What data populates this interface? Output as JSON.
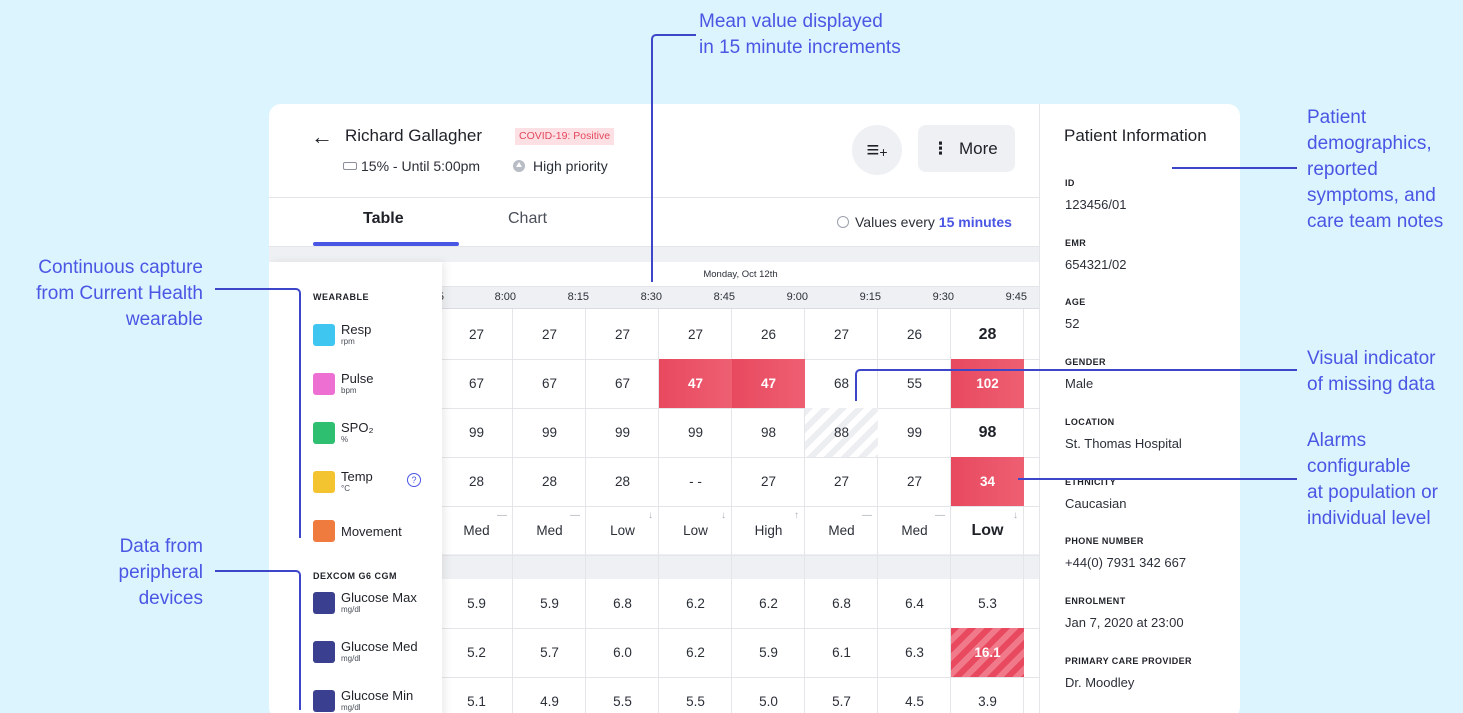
{
  "callouts": {
    "mean": [
      "Mean value displayed",
      "in 15 minute increments"
    ],
    "demographics": [
      "Patient",
      "demographics,",
      "reported",
      "symptoms, and",
      "care team notes"
    ],
    "continuous": [
      "Continuous capture",
      "from Current Health",
      "wearable"
    ],
    "missing": [
      "Visual indicator",
      "of missing data"
    ],
    "alarms": [
      "Alarms",
      "configurable",
      "at population or",
      "individual level"
    ],
    "peripheral": [
      "Data from",
      "peripheral",
      "devices"
    ]
  },
  "header": {
    "back_icon": "arrow-left-icon",
    "patient_name": "Richard Gallagher",
    "covid_badge": "COVID-19: Positive",
    "battery": "15% - Until 5:00pm",
    "priority": "High priority",
    "add_icon": "playlist-add-icon",
    "more_label": "More"
  },
  "tabs": {
    "table": "Table",
    "chart": "Chart",
    "values_prefix": "Values every ",
    "values_interval": "15 minutes"
  },
  "table": {
    "date": "Monday, Oct 12th",
    "times": [
      "8:00",
      "8:15",
      "8:30",
      "8:45",
      "9:00",
      "9:15",
      "9:30",
      "9:45"
    ],
    "partial_time": "5",
    "wearable_header": "WEARABLE",
    "cgm_header": "DEXCOM G6 CGM",
    "metrics": [
      {
        "name": "Resp",
        "unit": "rpm",
        "icon": "lungs-icon",
        "color": "#3fc6f0"
      },
      {
        "name": "Pulse",
        "unit": "bpm",
        "icon": "heart-icon",
        "color": "#ee6fd2"
      },
      {
        "name": "SPO₂",
        "unit": "%",
        "icon": "oxygen-icon",
        "color": "#2fbf71"
      },
      {
        "name": "Temp",
        "unit": "°C",
        "icon": "thermometer-icon",
        "color": "#f4c430"
      },
      {
        "name": "Movement",
        "unit": "",
        "icon": "activity-icon",
        "color": "#f07b3f"
      },
      {
        "name": "Glucose Max",
        "unit": "mg/dl",
        "icon": "glucose-meter-icon",
        "color": "#3a3f8f"
      },
      {
        "name": "Glucose Med",
        "unit": "mg/dl",
        "icon": "glucose-meter-icon",
        "color": "#3a3f8f"
      },
      {
        "name": "Glucose Min",
        "unit": "mg/dl",
        "icon": "glucose-meter-icon",
        "color": "#3a3f8f"
      }
    ],
    "rows": [
      [
        "27",
        "27",
        "27",
        "27",
        "26",
        "27",
        "26",
        "28"
      ],
      [
        "67",
        "67",
        "67",
        "47",
        "47",
        "68",
        "55",
        "102"
      ],
      [
        "99",
        "99",
        "99",
        "99",
        "98",
        "88",
        "99",
        "98"
      ],
      [
        "28",
        "28",
        "28",
        "- -",
        "27",
        "27",
        "27",
        "34"
      ],
      [
        "Med",
        "Med",
        "Low",
        "Low",
        "High",
        "Med",
        "Med",
        "Low"
      ],
      [
        "5.9",
        "5.9",
        "6.8",
        "6.2",
        "6.2",
        "6.8",
        "6.4",
        "5.3"
      ],
      [
        "5.2",
        "5.7",
        "6.0",
        "6.2",
        "5.9",
        "6.1",
        "6.3",
        "16.1"
      ],
      [
        "5.1",
        "4.9",
        "5.5",
        "5.5",
        "5.0",
        "5.7",
        "4.5",
        "3.9"
      ]
    ],
    "movement_arrows": [
      "—",
      "—",
      "↓",
      "↓",
      "↑",
      "—",
      "—",
      "↓"
    ]
  },
  "patient_info": {
    "title": "Patient Information",
    "fields": [
      {
        "label": "ID",
        "value": "123456/01"
      },
      {
        "label": "EMR",
        "value": "654321/02"
      },
      {
        "label": "AGE",
        "value": "52"
      },
      {
        "label": "GENDER",
        "value": "Male"
      },
      {
        "label": "LOCATION",
        "value": "St. Thomas Hospital"
      },
      {
        "label": "ETHNICITY",
        "value": "Caucasian"
      },
      {
        "label": "PHONE NUMBER",
        "value": "+44(0) 7931 342 667"
      },
      {
        "label": "ENROLMENT",
        "value": "Jan 7, 2020 at 23:00"
      },
      {
        "label": "PRIMARY CARE PROVIDER",
        "value": "Dr. Moodley"
      }
    ]
  },
  "colors": {
    "accent": "#4a56e4",
    "alert": "#e8495f",
    "background": "#dcf4fd"
  }
}
